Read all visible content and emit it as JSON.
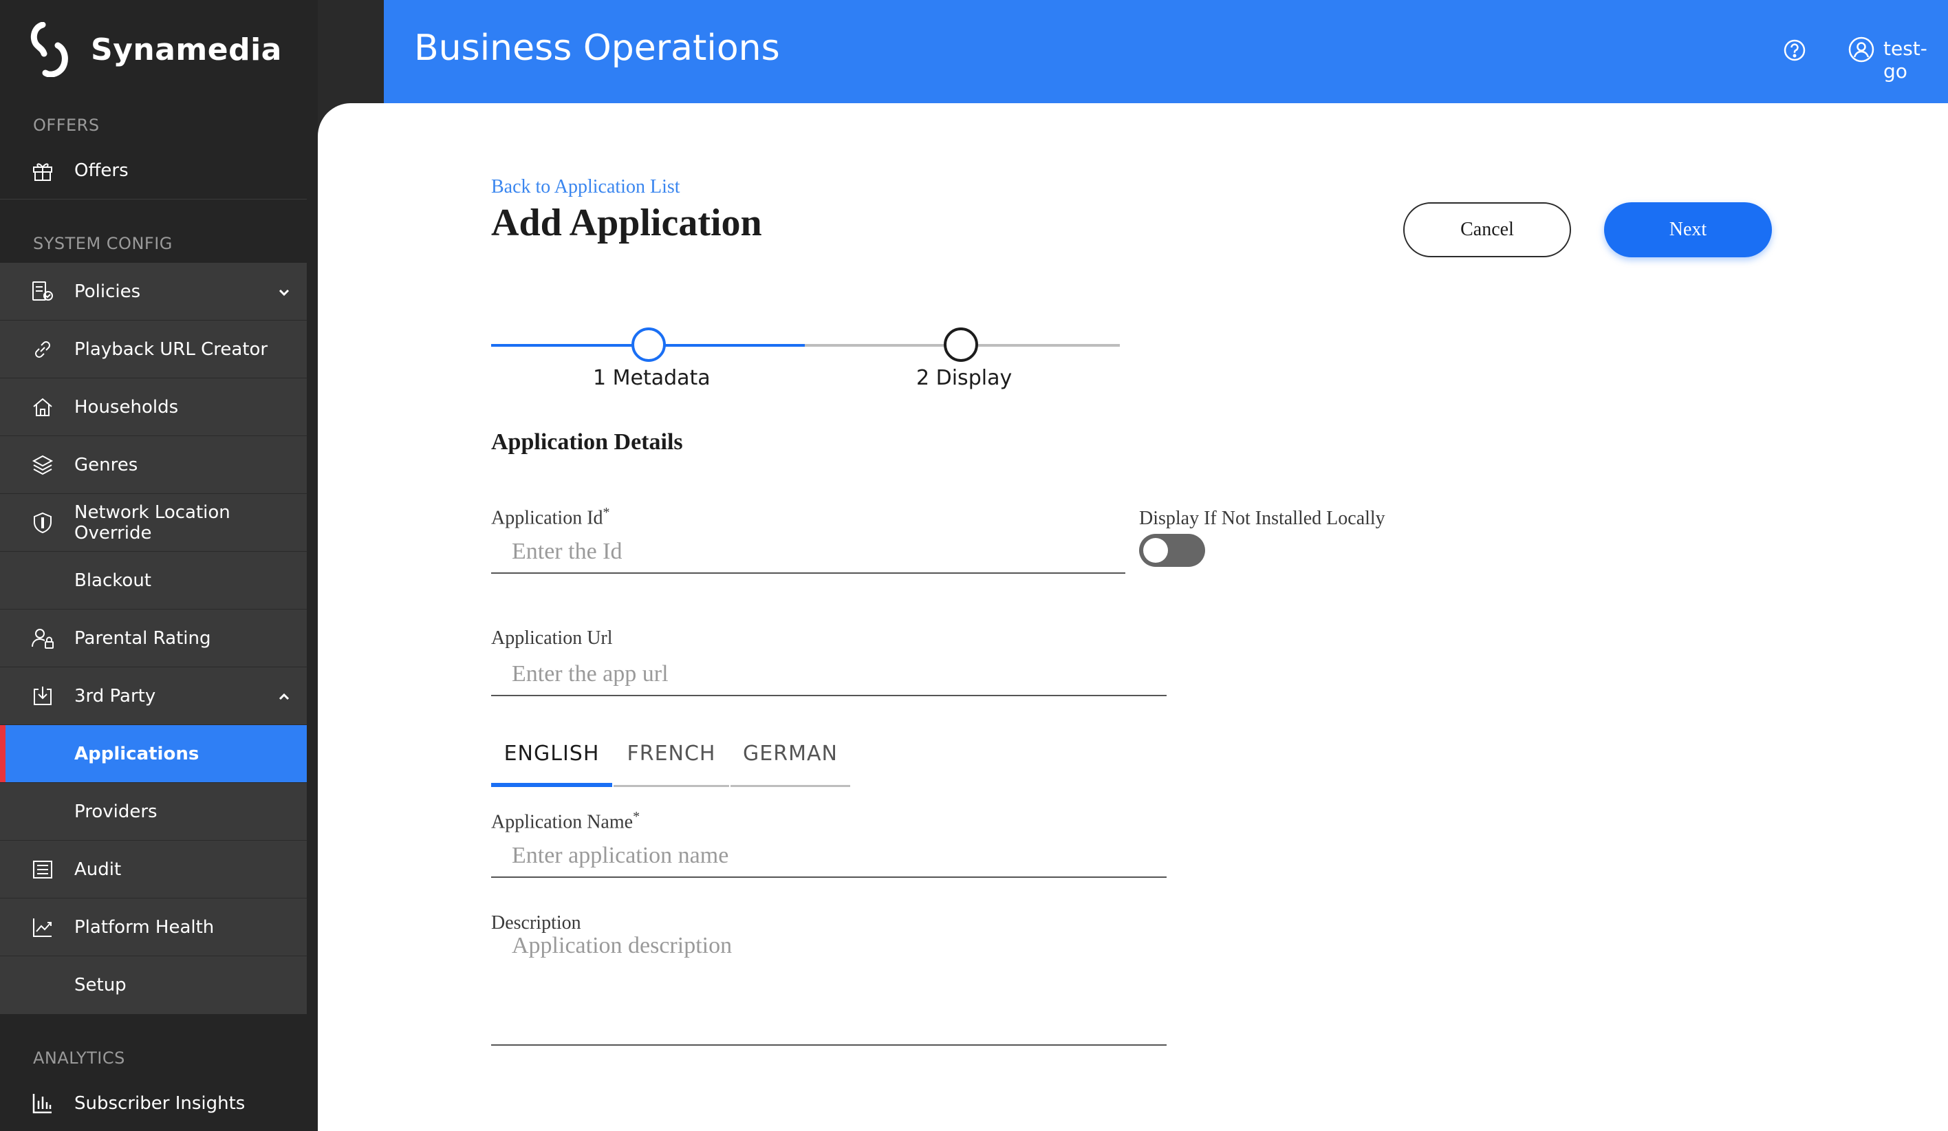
{
  "app": {
    "brand": "Synamedia",
    "header_title": "Business Operations",
    "user_name": "test-go"
  },
  "sidebar": {
    "sections": {
      "offers": "OFFERS",
      "system_config": "SYSTEM CONFIG",
      "analytics": "ANALYTICS"
    },
    "offers_item": "Offers",
    "items": [
      {
        "label": "Policies",
        "icon": "policy-icon",
        "chevron": "down"
      },
      {
        "label": "Playback URL Creator",
        "icon": "link-icon"
      },
      {
        "label": "Households",
        "icon": "home-icon"
      },
      {
        "label": "Genres",
        "icon": "layers-icon"
      },
      {
        "label": "Network Location Override",
        "icon": "shield-icon"
      },
      {
        "label": "Blackout",
        "icon": ""
      },
      {
        "label": "Parental Rating",
        "icon": "user-lock-icon"
      },
      {
        "label": "3rd Party",
        "icon": "download-box-icon",
        "chevron": "up"
      },
      {
        "label": "Applications",
        "icon": "",
        "active": true
      },
      {
        "label": "Providers",
        "icon": ""
      },
      {
        "label": "Audit",
        "icon": "list-icon"
      },
      {
        "label": "Platform Health",
        "icon": "trend-chart-icon"
      },
      {
        "label": "Setup",
        "icon": ""
      }
    ],
    "analytics_item": "Subscriber Insights"
  },
  "page": {
    "back_link": "Back to Application List",
    "title": "Add Application",
    "cancel_label": "Cancel",
    "next_label": "Next"
  },
  "stepper": {
    "steps": [
      "1 Metadata",
      "2 Display"
    ],
    "current_step": 1
  },
  "form": {
    "section_title": "Application Details",
    "app_id_label": "Application Id",
    "app_id_placeholder": "Enter the Id",
    "app_id_value": "",
    "display_toggle_label": "Display If Not Installed Locally",
    "display_toggle_on": false,
    "app_url_label": "Application Url",
    "app_url_placeholder": "Enter the app url",
    "app_url_value": "",
    "languages": [
      "ENGLISH",
      "FRENCH",
      "GERMAN"
    ],
    "active_language": "ENGLISH",
    "app_name_label": "Application Name",
    "app_name_placeholder": "Enter application name",
    "app_name_value": "",
    "description_label": "Description",
    "description_placeholder": "Application description",
    "description_value": "",
    "required_mark": "*"
  },
  "colors": {
    "accent": "#2f7ff5",
    "primary_button": "#1a6ff4",
    "active_marker": "#e8343c",
    "sidebar_bg": "#252525",
    "sidebar_group_bg": "#3a3a3a"
  }
}
